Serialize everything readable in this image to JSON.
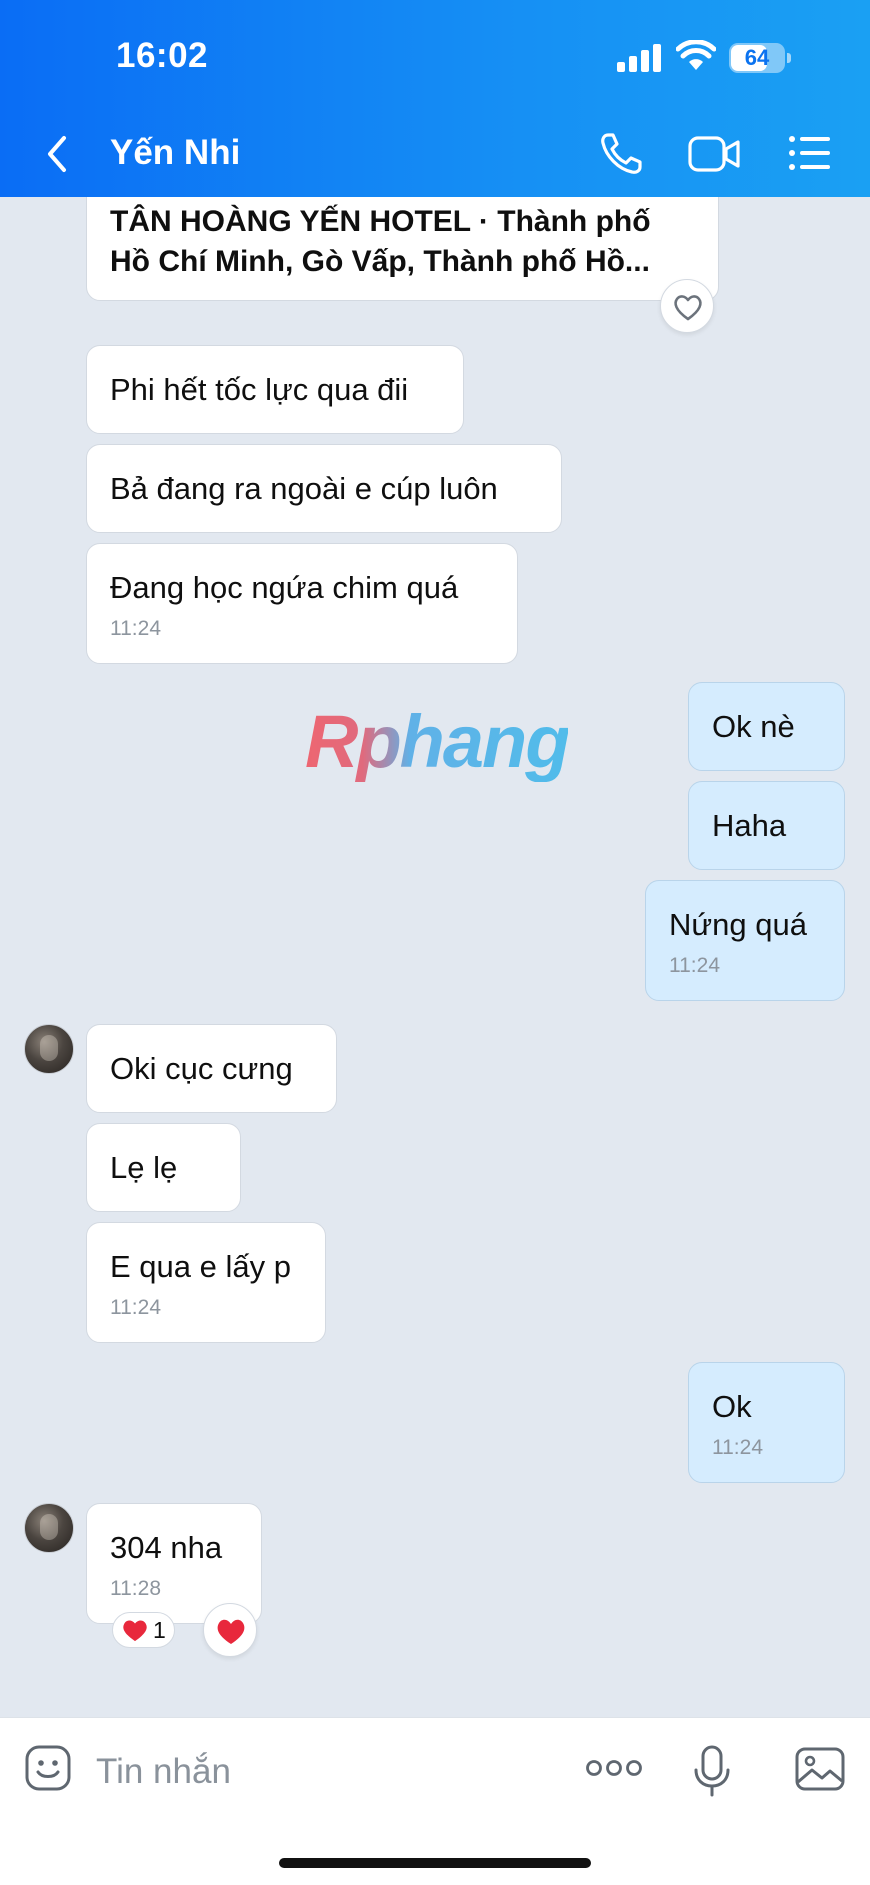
{
  "status_bar": {
    "time": "16:02",
    "battery": "64"
  },
  "header": {
    "contact_name": "Yến Nhi",
    "icons": [
      "chevron-left-icon",
      "phone-icon",
      "video-camera-icon",
      "list-menu-icon"
    ]
  },
  "messages": {
    "link_preview": {
      "line1": "TÂN HOÀNG YẾN HOTEL · Thành phố",
      "line2": "Hồ Chí Minh, Gò Vấp, Thành phố Hồ..."
    },
    "m1": {
      "text": "Phi hết tốc lực qua đii"
    },
    "m2": {
      "text": "Bả đang ra ngoài e cúp luôn"
    },
    "m3": {
      "text": "Đang học ngứa chim quá",
      "time": "11:24"
    },
    "m4": {
      "text": "Ok nè"
    },
    "m5": {
      "text": "Haha"
    },
    "m6": {
      "text": "Nứng quá",
      "time": "11:24"
    },
    "m7": {
      "text": "Oki cục cưng"
    },
    "m8": {
      "text": "Lẹ lẹ"
    },
    "m9": {
      "text": "E qua e lấy p",
      "time": "11:24"
    },
    "m10": {
      "text": "Ok",
      "time": "11:24"
    },
    "m11": {
      "text": "304 nha",
      "time": "11:28",
      "reaction_count": "1"
    }
  },
  "watermark": "Rphang",
  "composer": {
    "placeholder": "Tin nhắn",
    "icons": [
      "sticker-smile-icon",
      "more-dots-icon",
      "microphone-icon",
      "image-icon"
    ]
  },
  "colors": {
    "header_gradient_start": "#0a6df5",
    "header_gradient_end": "#1aa0f3",
    "chat_background": "#e2e8f0",
    "incoming_bubble": "#ffffff",
    "outgoing_bubble": "#d5ecfe",
    "heart": "#e8283c"
  }
}
